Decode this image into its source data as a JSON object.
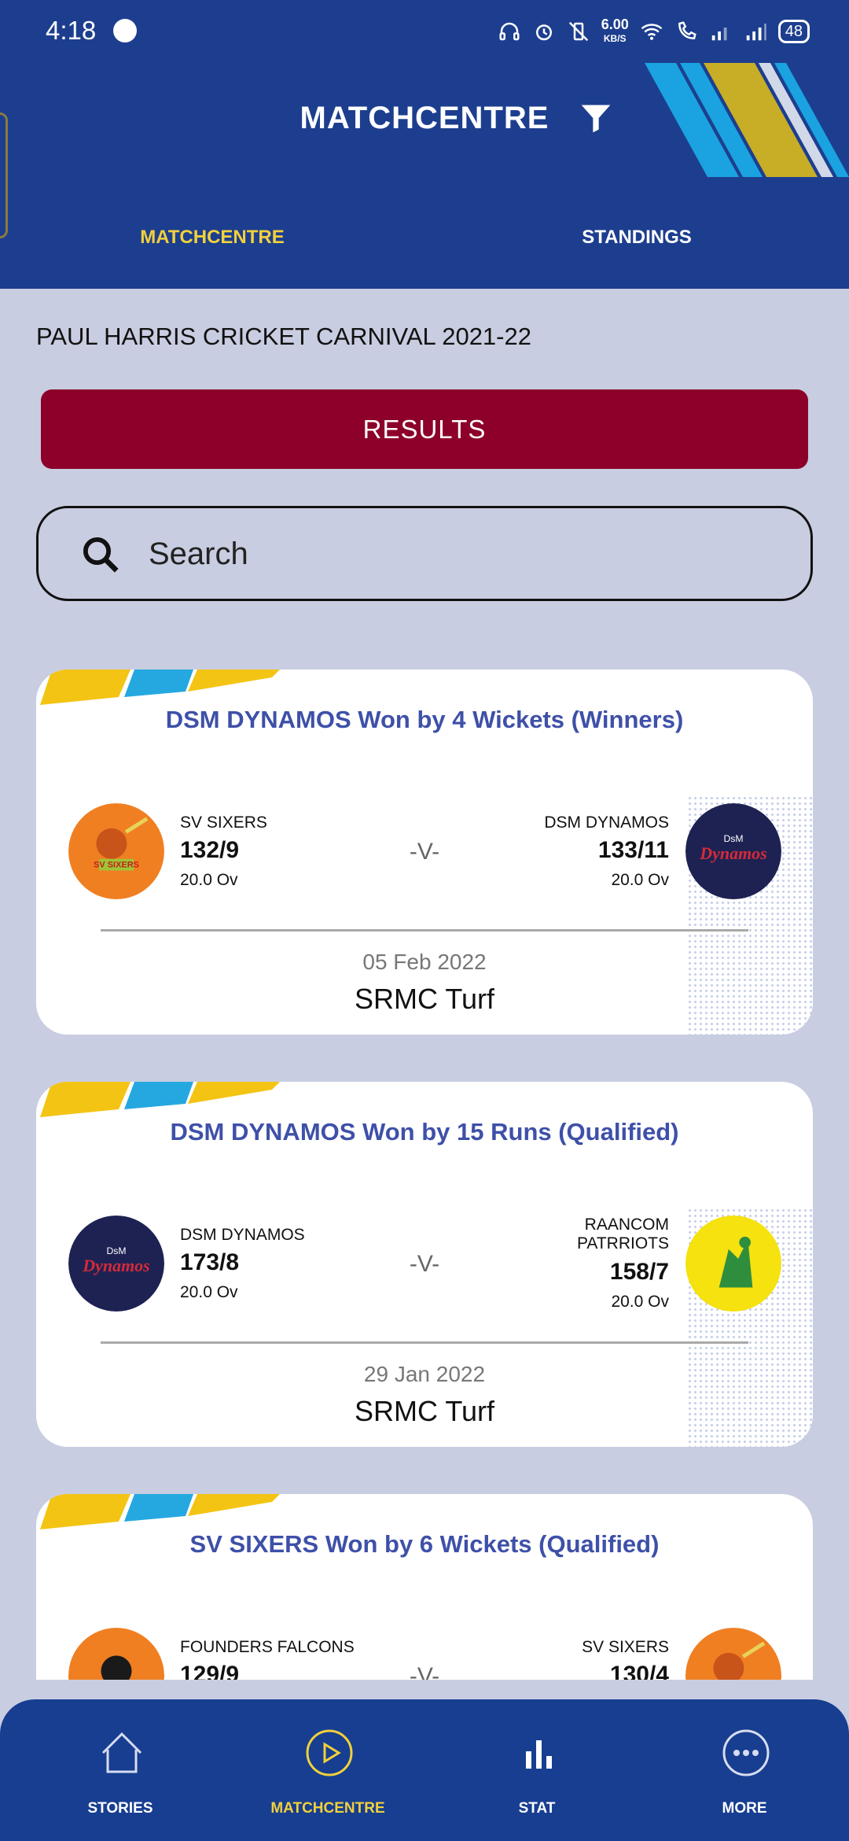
{
  "status_bar": {
    "time": "4:18",
    "speed": "6.00",
    "speed_unit": "KB/S",
    "battery": "48"
  },
  "header": {
    "title": "MATCHCENTRE",
    "tabs": [
      {
        "label": "MATCHCENTRE",
        "active": true
      },
      {
        "label": "STANDINGS",
        "active": false
      }
    ]
  },
  "tournament": "PAUL HARRIS CRICKET CARNIVAL 2021-22",
  "results_button": "RESULTS",
  "search": {
    "placeholder": "Search"
  },
  "matches": [
    {
      "result": "DSM DYNAMOS Won by 4 Wickets (Winners)",
      "team1": {
        "name": "SV SIXERS",
        "score": "132/9",
        "overs": "20.0 Ov"
      },
      "team2": {
        "name": "DSM DYNAMOS",
        "score": "133/11",
        "overs": "20.0 Ov"
      },
      "vs": "-V-",
      "date": "05 Feb 2022",
      "venue": "SRMC Turf"
    },
    {
      "result": "DSM DYNAMOS Won by 15 Runs (Qualified)",
      "team1": {
        "name": "DSM DYNAMOS",
        "score": "173/8",
        "overs": "20.0 Ov"
      },
      "team2": {
        "name": "RAANCOM PATRRIOTS",
        "score": "158/7",
        "overs": "20.0 Ov"
      },
      "vs": "-V-",
      "date": "29 Jan 2022",
      "venue": "SRMC Turf"
    },
    {
      "result": "SV SIXERS Won by 6 Wickets (Qualified)",
      "team1": {
        "name": "FOUNDERS FALCONS",
        "score": "129/9"
      },
      "team2": {
        "name": "SV SIXERS",
        "score": "130/4"
      },
      "vs": "-V-"
    }
  ],
  "bottom_nav": [
    {
      "label": "STORIES",
      "icon": "home-icon",
      "active": false
    },
    {
      "label": "MATCHCENTRE",
      "icon": "play-icon",
      "active": true
    },
    {
      "label": "STAT",
      "icon": "bar-chart-icon",
      "active": false
    },
    {
      "label": "MORE",
      "icon": "more-icon",
      "active": false
    }
  ],
  "colors": {
    "primary": "#1d3e8e",
    "accent": "#f1d03c",
    "results": "#8c0029",
    "result_text": "#3e50a8",
    "background": "#c9cde1"
  }
}
